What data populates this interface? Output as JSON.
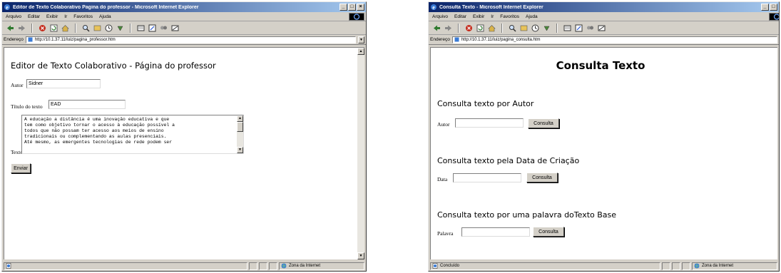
{
  "left_window": {
    "title": "Editor de Texto Colaborativo Pagina do professor - Microsoft Internet Explorer",
    "menu": [
      "Arquivo",
      "Editar",
      "Exibir",
      "Ir",
      "Favoritos",
      "Ajuda"
    ],
    "address_label": "Endereço",
    "address": "http://10.1.37.11/luiz/pagina_professor.htm",
    "page": {
      "heading": "Editor de Texto Colaborativo - Página do professor",
      "author_label": "Autor",
      "author_value": "Sidner",
      "title_label": "Título do texto",
      "title_value": "EAD",
      "text_label": "Texto",
      "text_lines": [
        "A educação a distância é uma inovação educativa e que",
        "tem como objetivo tornar o acesso à educação possível a",
        "todos que não possam ter acesso aos meios de ensino",
        "tradicionais ou complementando as aulas presenciais.",
        "Até mesmo, as emergentes tecnologias de rede podem ser"
      ],
      "submit_label": "Enviar"
    },
    "status": {
      "text": "",
      "zone": "Zona da Internet"
    }
  },
  "right_window": {
    "title": "Consulta Texto - Microsoft Internet Explorer",
    "menu": [
      "Arquivo",
      "Editar",
      "Exibir",
      "Ir",
      "Favoritos",
      "Ajuda"
    ],
    "address_label": "Endereço",
    "address": "http://10.1.37.11/luiz/pagina_consulta.htm",
    "page": {
      "heading": "Consulta Texto",
      "sections": [
        {
          "heading": "Consulta texto por Autor",
          "label": "Autor",
          "value": "",
          "button": "Consulta"
        },
        {
          "heading": "Consulta texto pela Data de Criação",
          "label": "Data",
          "value": "",
          "button": "Consulta"
        },
        {
          "heading": "Consulta texto por uma palavra doTexto Base",
          "label": "Palavra",
          "value": "",
          "button": "Consulta"
        }
      ]
    },
    "status": {
      "text": "Concluído",
      "zone": "Zona da Internet"
    }
  },
  "icons": [
    "ie-logo-icon",
    "back-icon",
    "forward-icon",
    "stop-icon",
    "refresh-icon",
    "home-icon",
    "search-icon",
    "favorites-icon",
    "history-icon",
    "mail-icon",
    "print-icon",
    "edit-icon",
    "discuss-icon",
    "messenger-icon",
    "page-icon",
    "globe-icon"
  ],
  "colors": {
    "titlebar_start": "#0a246a",
    "titlebar_end": "#a6caf0",
    "chrome": "#d4d0c8"
  }
}
